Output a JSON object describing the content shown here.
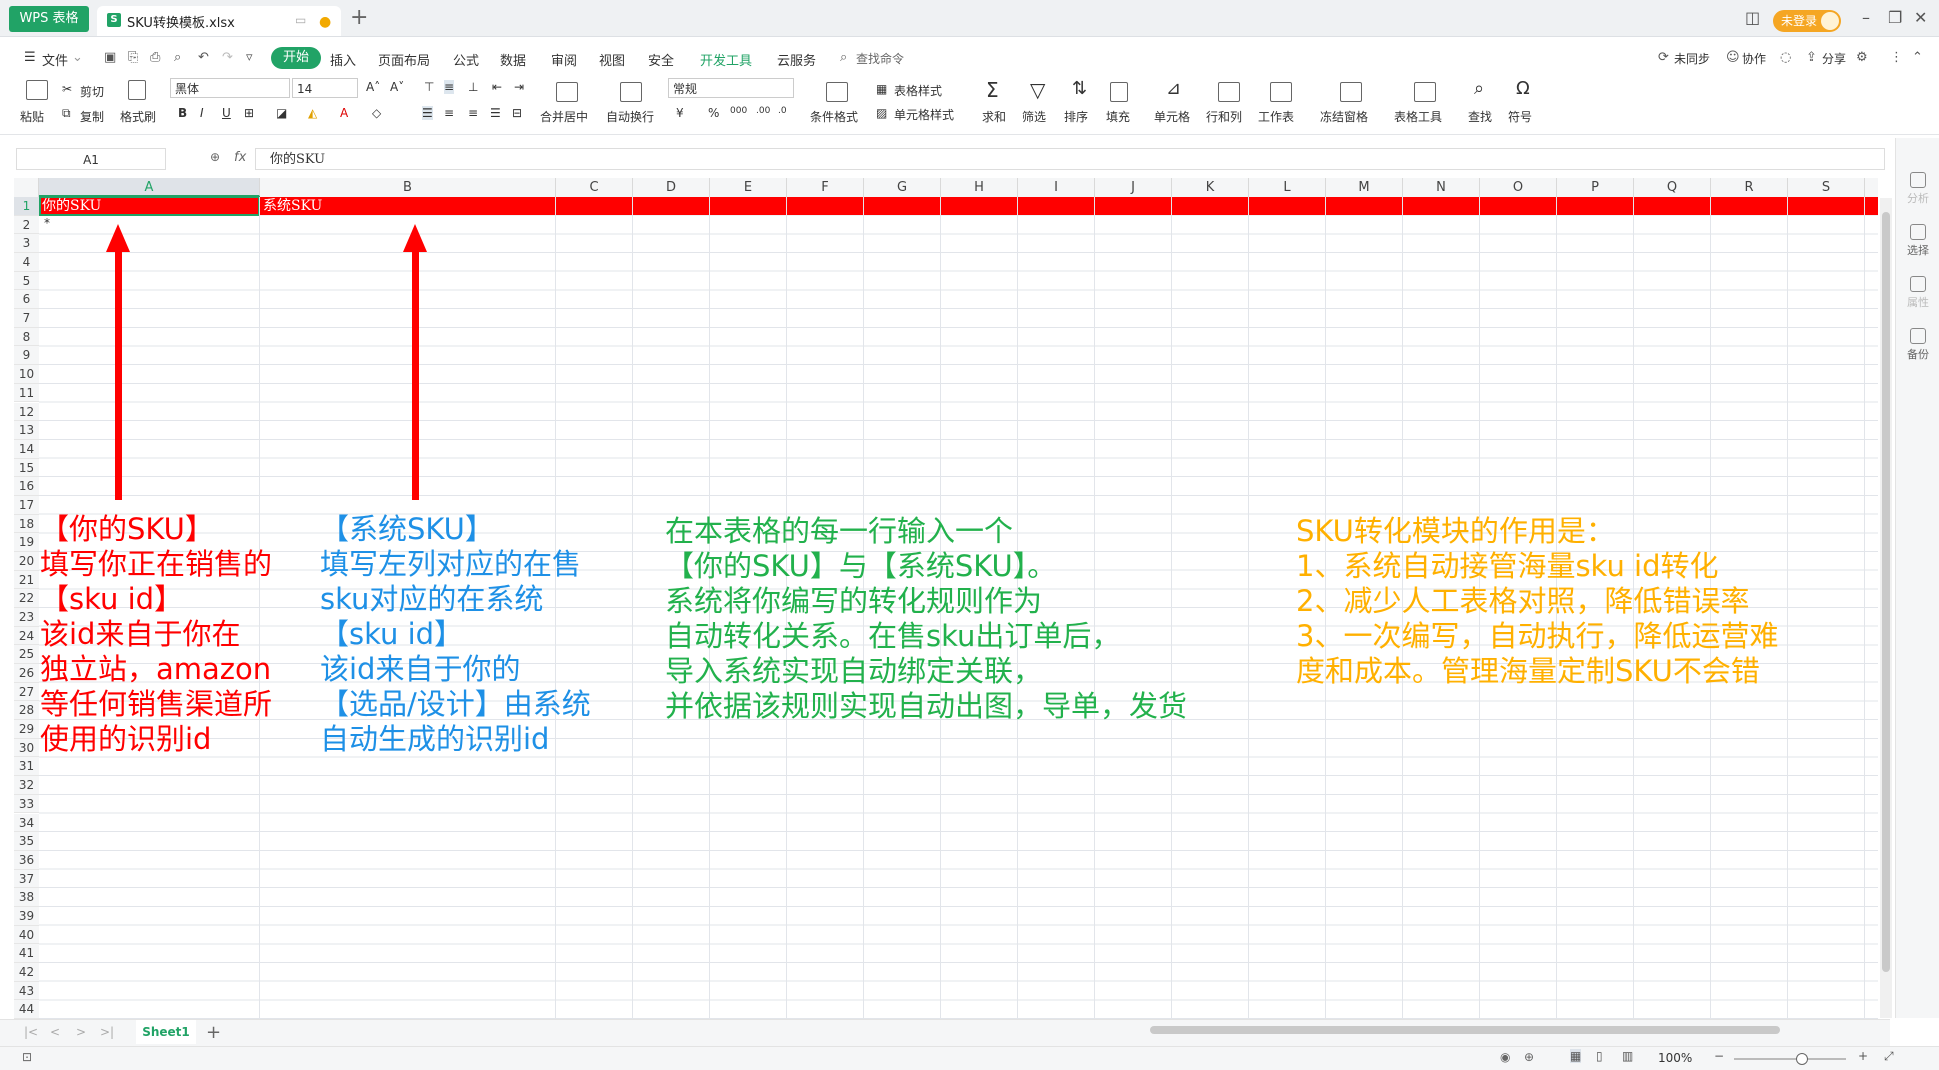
{
  "app": {
    "product_tab": "WPS 表格",
    "file_tab": "SKU转换模板.xlsx",
    "login_label": "未登录"
  },
  "menu": {
    "items": [
      "文件",
      "开始",
      "插入",
      "页面布局",
      "公式",
      "数据",
      "审阅",
      "视图",
      "安全",
      "开发工具",
      "云服务"
    ],
    "search": "查找命令",
    "right": [
      "未同步",
      "协作",
      "分享"
    ]
  },
  "ribbon": {
    "paste": "粘贴",
    "cut": "剪切",
    "copy": "复制",
    "format_painter": "格式刷",
    "font_name": "黑体",
    "font_size": "14",
    "merge_center": "合并居中",
    "wrap": "自动换行",
    "number_format": "常规",
    "cond_format": "条件格式",
    "table_style": "表格样式",
    "cell_style": "单元格样式",
    "sum": "求和",
    "filter": "筛选",
    "sort": "排序",
    "fill": "填充",
    "cell": "单元格",
    "row_col": "行和列",
    "worksheet": "工作表",
    "freeze": "冻结窗格",
    "table_tools": "表格工具",
    "find": "查找",
    "symbol": "符号"
  },
  "formula_bar": {
    "name_box": "A1",
    "fx": "fx",
    "value": "你的SKU"
  },
  "columns": [
    "A",
    "B",
    "C",
    "D",
    "E",
    "F",
    "G",
    "H",
    "I",
    "J",
    "K",
    "L",
    "M",
    "N",
    "O",
    "P",
    "Q",
    "R",
    "S"
  ],
  "rows": [
    "1",
    "2",
    "3",
    "4",
    "5",
    "6",
    "7",
    "8",
    "9",
    "10",
    "11",
    "12",
    "13",
    "14",
    "15",
    "16",
    "17",
    "18",
    "19",
    "20",
    "21",
    "22",
    "23",
    "24",
    "25",
    "26",
    "27",
    "28",
    "29",
    "30",
    "31",
    "32",
    "33",
    "34",
    "35",
    "36",
    "37",
    "38",
    "39",
    "40",
    "41",
    "42",
    "43",
    "44"
  ],
  "cells": {
    "A1": "你的SKU",
    "B1": "系统SKU",
    "A2": "*"
  },
  "annotations": {
    "red": [
      "【你的SKU】",
      "填写你正在销售的",
      "【sku id】",
      "该id来自于你在",
      "独立站，amazon",
      "等任何销售渠道所",
      "使用的识别id"
    ],
    "blue": [
      "【系统SKU】",
      "填写左列对应的在售",
      "sku对应的在系统",
      "【sku id】",
      "该id来自于你的",
      "【选品/设计】由系统",
      "自动生成的识别id"
    ],
    "green": [
      "在本表格的每一行输入一个",
      "【你的SKU】与【系统SKU】。",
      "系统将你编写的转化规则作为",
      "自动转化关系。在售sku出订单后，",
      "导入系统实现自动绑定关联，",
      "并依据该规则实现自动出图，导单，发货"
    ],
    "orange": [
      "SKU转化模块的作用是：",
      "1、系统自动接管海量sku id转化",
      "2、减少人工表格对照，降低错误率",
      "3、一次编写，自动执行，降低运营难",
      "度和成本。管理海量定制SKU不会错"
    ]
  },
  "colors": {
    "accent": "#21a366",
    "row1_fill": "#ff0000",
    "ann_red": "#ff0000",
    "ann_blue": "#1e90e6",
    "ann_green": "#22b14c",
    "ann_orange": "#ffb000"
  },
  "sheet": {
    "tab": "Sheet1"
  },
  "sidebar": [
    "分析",
    "选择",
    "属性",
    "备份"
  ],
  "status": {
    "zoom": "100%"
  }
}
